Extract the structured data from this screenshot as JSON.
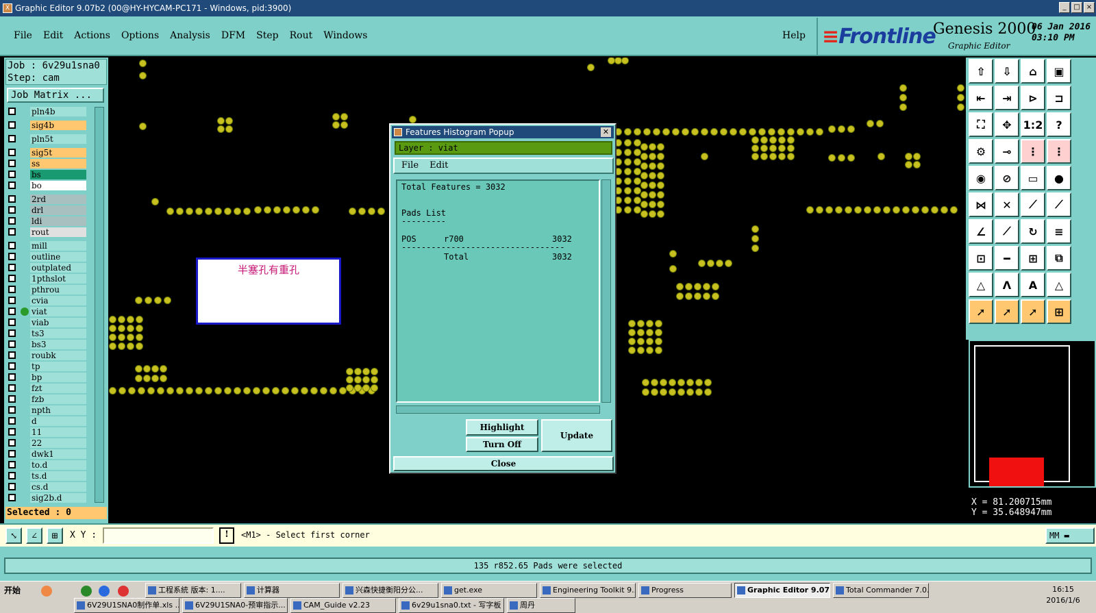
{
  "window": {
    "title": "Graphic Editor 9.07b2 (00@HY-HYCAM-PC171 - Windows, pid:3900)",
    "app_icon": "x-icon"
  },
  "menubar": {
    "items": [
      "File",
      "Edit",
      "Actions",
      "Options",
      "Analysis",
      "DFM",
      "Step",
      "Rout",
      "Windows"
    ],
    "help": "Help"
  },
  "brand": {
    "logo": "Frontline",
    "product": "Genesis 2000",
    "subtitle": "Graphic Editor",
    "date": "06 Jan 2016",
    "time": "03:10 PM"
  },
  "job": {
    "job_line": "Job : 6v29u1sna0",
    "step_line": "Step: cam",
    "matrix_button": "Job Matrix ..."
  },
  "layers": [
    {
      "name": "pln4b",
      "color": "#9fe0d8"
    },
    {
      "name": "sig4b",
      "color": "#ffc870"
    },
    {
      "name": "pln5t",
      "color": "#9fe0d8"
    },
    {
      "name": "sig5t",
      "color": "#ffc870"
    },
    {
      "name": "ss",
      "color": "#ffc870"
    },
    {
      "name": "bs",
      "color": "#1a9a70"
    },
    {
      "name": "bo",
      "color": "#ffffff"
    },
    {
      "name": "2rd",
      "color": "#a8c0c0"
    },
    {
      "name": "drl",
      "color": "#a8c0c0"
    },
    {
      "name": "ldi",
      "color": "#a8c0c0"
    },
    {
      "name": "rout",
      "color": "#e0e0e0"
    },
    {
      "name": "mill",
      "color": "#9fe0d8"
    },
    {
      "name": "outline",
      "color": "#9fe0d8"
    },
    {
      "name": "outplated",
      "color": "#9fe0d8"
    },
    {
      "name": "1pthslot",
      "color": "#9fe0d8"
    },
    {
      "name": "pthrou",
      "color": "#9fe0d8"
    },
    {
      "name": "cvia",
      "color": "#9fe0d8"
    },
    {
      "name": "viat",
      "color": "#9fe0d8",
      "active": true
    },
    {
      "name": "viab",
      "color": "#9fe0d8"
    },
    {
      "name": "ts3",
      "color": "#9fe0d8"
    },
    {
      "name": "bs3",
      "color": "#9fe0d8"
    },
    {
      "name": "roubk",
      "color": "#9fe0d8"
    },
    {
      "name": "tp",
      "color": "#9fe0d8"
    },
    {
      "name": "bp",
      "color": "#9fe0d8"
    },
    {
      "name": "fzt",
      "color": "#9fe0d8"
    },
    {
      "name": "fzb",
      "color": "#9fe0d8"
    },
    {
      "name": "npth",
      "color": "#9fe0d8"
    },
    {
      "name": "d",
      "color": "#9fe0d8"
    },
    {
      "name": "11",
      "color": "#9fe0d8"
    },
    {
      "name": "22",
      "color": "#9fe0d8"
    },
    {
      "name": "dwk1",
      "color": "#9fe0d8"
    },
    {
      "name": "to.d",
      "color": "#9fe0d8"
    },
    {
      "name": "ts.d",
      "color": "#9fe0d8"
    },
    {
      "name": "cs.d",
      "color": "#9fe0d8"
    },
    {
      "name": "sig2b.d",
      "color": "#9fe0d8"
    }
  ],
  "selected": "Selected : 0",
  "canvas_note": "半塞孔有重孔",
  "popup": {
    "title": "Features Histogram Popup",
    "layer": "Layer :  viat",
    "menu": [
      "File",
      "Edit"
    ],
    "total_features": "Total Features = 3032",
    "pads_list": "Pads List",
    "pads_underline": "---------",
    "row_pos": "POS",
    "row_sym": "r700",
    "row_count": "3032",
    "separator": "---------------------------------",
    "total_label": "Total",
    "total_count": "3032",
    "highlight": "Highlight",
    "turn_off": "Turn Off",
    "update": "Update",
    "close": "Close"
  },
  "coords": {
    "x": "X  =  81.200715mm",
    "y": "Y  =  35.648947mm"
  },
  "command": {
    "xy_label": "X Y :",
    "xy_value": "",
    "prompt": "<M1> - Select first corner",
    "units": "MM"
  },
  "status": "135 r852.65 Pads were selected",
  "taskbar": {
    "start": "开始",
    "row1": [
      "工程系統  版本: 1....",
      "计算器",
      "兴森快捷衡阳分公...",
      "get.exe",
      "Engineering Toolkit 9....",
      "Progress",
      "Graphic Editor 9.07...",
      "Total Commander 7.0..."
    ],
    "row2": [
      "6V29U1SNA0制作单.xls ...",
      "6V29U1SNA0-预审指示...",
      "CAM_Guide v2.23",
      "6v29u1sna0.txt - 写字板",
      "周丹"
    ],
    "clock_time": "16:15",
    "clock_date": "2016/1/6"
  }
}
